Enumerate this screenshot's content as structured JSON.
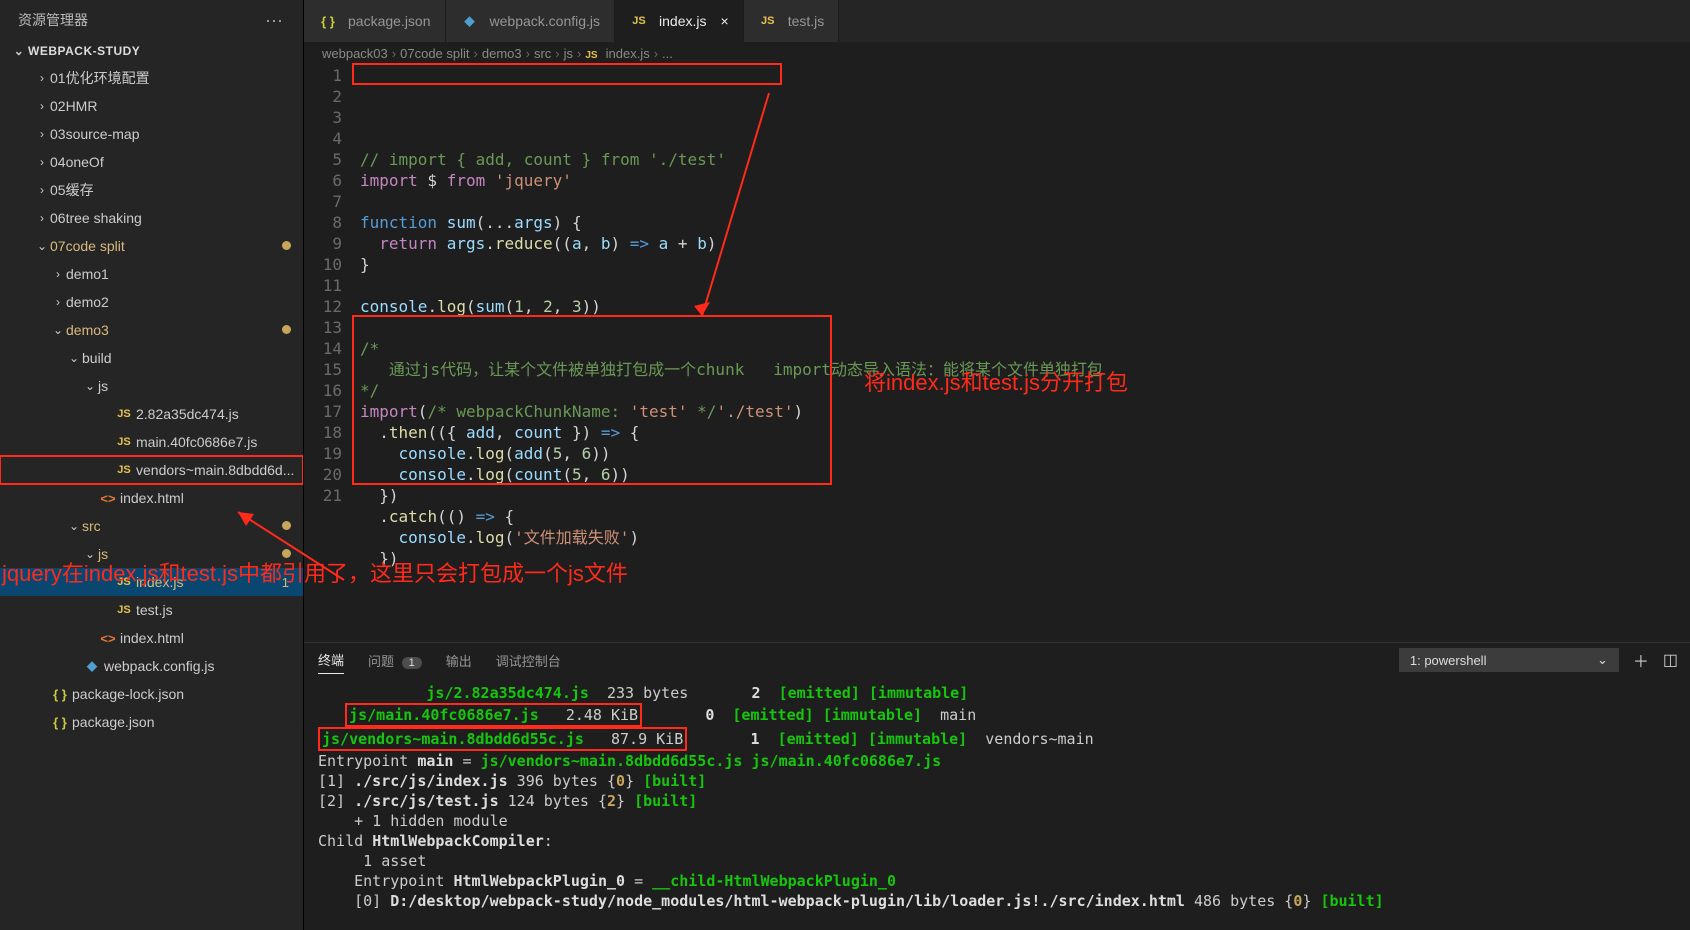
{
  "sidebar": {
    "title": "资源管理器",
    "project": "WEBPACK-STUDY",
    "items": [
      {
        "name": "01优化环境配置",
        "kind": "folder",
        "depth": 1,
        "open": false
      },
      {
        "name": "02HMR",
        "kind": "folder",
        "depth": 1,
        "open": false
      },
      {
        "name": "03source-map",
        "kind": "folder",
        "depth": 1,
        "open": false
      },
      {
        "name": "04oneOf",
        "kind": "folder",
        "depth": 1,
        "open": false
      },
      {
        "name": "05缓存",
        "kind": "folder",
        "depth": 1,
        "open": false
      },
      {
        "name": "06tree shaking",
        "kind": "folder",
        "depth": 1,
        "open": false
      },
      {
        "name": "07code split",
        "kind": "folder",
        "depth": 1,
        "open": true,
        "mod": true,
        "yellow": true
      },
      {
        "name": "demo1",
        "kind": "folder",
        "depth": 2,
        "open": false
      },
      {
        "name": "demo2",
        "kind": "folder",
        "depth": 2,
        "open": false
      },
      {
        "name": "demo3",
        "kind": "folder",
        "depth": 2,
        "open": true,
        "mod": true,
        "yellow": true
      },
      {
        "name": "build",
        "kind": "folder",
        "depth": 3,
        "open": true
      },
      {
        "name": "js",
        "kind": "folder",
        "depth": 4,
        "open": true
      },
      {
        "name": "2.82a35dc474.js",
        "kind": "js",
        "depth": 5
      },
      {
        "name": "main.40fc0686e7.js",
        "kind": "js",
        "depth": 5
      },
      {
        "name": "vendors~main.8dbdd6d...",
        "kind": "js",
        "depth": 5,
        "boxed": true
      },
      {
        "name": "index.html",
        "kind": "html",
        "depth": 4
      },
      {
        "name": "src",
        "kind": "folder",
        "depth": 3,
        "open": true,
        "hidden_label": true,
        "mod": true,
        "yellow": true
      },
      {
        "name": "js",
        "kind": "folder",
        "depth": 4,
        "open": true,
        "mod": true,
        "yellow": true
      },
      {
        "name": "index.js",
        "kind": "js",
        "depth": 5,
        "active": true,
        "yellow": true,
        "modnum": "1"
      },
      {
        "name": "test.js",
        "kind": "js",
        "depth": 5
      },
      {
        "name": "index.html",
        "kind": "html",
        "depth": 4
      },
      {
        "name": "webpack.config.js",
        "kind": "wp",
        "depth": 3
      },
      {
        "name": "package-lock.json",
        "kind": "json",
        "depth": 1
      },
      {
        "name": "package.json",
        "kind": "json",
        "depth": 1
      }
    ]
  },
  "tabs": [
    {
      "icon": "json",
      "label": "package.json"
    },
    {
      "icon": "wp",
      "label": "webpack.config.js"
    },
    {
      "icon": "js",
      "label": "index.js",
      "active": true,
      "close": true
    },
    {
      "icon": "js",
      "label": "test.js"
    }
  ],
  "breadcrumb": [
    "webpack03",
    "07code split",
    "demo3",
    "src",
    "js",
    "index.js",
    "..."
  ],
  "breadcrumb_icon_at": 5,
  "code_lines": [
    "// import { add, count } from './test'",
    "import $ from 'jquery'",
    "",
    "function sum(...args) {",
    "  return args.reduce((a, b) => a + b)",
    "}",
    "",
    "console.log(sum(1, 2, 3))",
    "",
    "/*",
    "   通过js代码，让某个文件被单独打包成一个chunk   import动态导入语法：能将某个文件单独打包",
    "*/",
    "import(/* webpackChunkName: 'test' */'./test')",
    "  .then(({ add, count }) => {",
    "    console.log(add(5, 6))",
    "    console.log(count(5, 6))",
    "  })",
    "  .catch(() => {",
    "    console.log('文件加载失败')",
    "  })",
    ""
  ],
  "annotations": {
    "right_text": "将index.js和test.js分开打包",
    "overlay_text": "jquery在index.js和test.js中都引用了，这里只会打包成一个js文件"
  },
  "panel": {
    "tabs": {
      "terminal": "终端",
      "problems": "问题",
      "problems_count": "1",
      "output": "输出",
      "debug": "调试控制台"
    },
    "shell": "1: powershell"
  },
  "terminal_lines": [
    {
      "segments": [
        {
          "t": "            ",
          "c": ""
        },
        {
          "t": "js/2.82a35dc474.js",
          "c": "g"
        },
        {
          "t": "  233 bytes       ",
          "c": ""
        },
        {
          "t": "2",
          "c": "w"
        },
        {
          "t": "  ",
          "c": ""
        },
        {
          "t": "[emitted] [immutable]",
          "c": "g"
        }
      ]
    },
    {
      "segments": [
        {
          "t": "   ",
          "c": ""
        },
        {
          "t": "js/main.40fc0686e7.js",
          "c": "g",
          "box": true
        },
        {
          "t": "   2.48 KiB",
          "c": "",
          "box": true
        },
        {
          "t": "       ",
          "c": ""
        },
        {
          "t": "0",
          "c": "w"
        },
        {
          "t": "  ",
          "c": ""
        },
        {
          "t": "[emitted] [immutable]",
          "c": "g"
        },
        {
          "t": "  main",
          "c": ""
        }
      ]
    },
    {
      "segments": [
        {
          "t": "",
          "c": ""
        },
        {
          "t": "js/vendors~main.8dbdd6d55c.js",
          "c": "g",
          "box": true
        },
        {
          "t": "   87.9 KiB",
          "c": "",
          "box": true
        },
        {
          "t": "       ",
          "c": ""
        },
        {
          "t": "1",
          "c": "w"
        },
        {
          "t": "  ",
          "c": ""
        },
        {
          "t": "[emitted] [immutable]",
          "c": "g"
        },
        {
          "t": "  vendors~main",
          "c": ""
        }
      ]
    },
    {
      "segments": [
        {
          "t": "Entrypoint ",
          "c": ""
        },
        {
          "t": "main",
          "c": "w"
        },
        {
          "t": " = ",
          "c": ""
        },
        {
          "t": "js/vendors~main.8dbdd6d55c.js js/main.40fc0686e7.js",
          "c": "g"
        }
      ]
    },
    {
      "segments": [
        {
          "t": "[1] ",
          "c": ""
        },
        {
          "t": "./src/js/index.js",
          "c": "w"
        },
        {
          "t": " 396 bytes {",
          "c": ""
        },
        {
          "t": "0",
          "c": "y"
        },
        {
          "t": "} ",
          "c": ""
        },
        {
          "t": "[built]",
          "c": "g"
        }
      ]
    },
    {
      "segments": [
        {
          "t": "[2] ",
          "c": ""
        },
        {
          "t": "./src/js/test.js",
          "c": "w"
        },
        {
          "t": " 124 bytes {",
          "c": ""
        },
        {
          "t": "2",
          "c": "y"
        },
        {
          "t": "} ",
          "c": ""
        },
        {
          "t": "[built]",
          "c": "g"
        }
      ]
    },
    {
      "segments": [
        {
          "t": "    + 1 hidden module",
          "c": ""
        }
      ]
    },
    {
      "segments": [
        {
          "t": "Child ",
          "c": ""
        },
        {
          "t": "HtmlWebpackCompiler",
          "c": "w"
        },
        {
          "t": ":",
          "c": ""
        }
      ]
    },
    {
      "segments": [
        {
          "t": "     1 asset",
          "c": ""
        }
      ]
    },
    {
      "segments": [
        {
          "t": "    Entrypoint ",
          "c": ""
        },
        {
          "t": "HtmlWebpackPlugin_0",
          "c": "w"
        },
        {
          "t": " = ",
          "c": ""
        },
        {
          "t": "__child-HtmlWebpackPlugin_0",
          "c": "g"
        }
      ]
    },
    {
      "segments": [
        {
          "t": "    [0] ",
          "c": ""
        },
        {
          "t": "D:/desktop/webpack-study/node_modules/html-webpack-plugin/lib/loader.js!./src/index.html",
          "c": "w"
        },
        {
          "t": " 486 bytes {",
          "c": ""
        },
        {
          "t": "0",
          "c": "y"
        },
        {
          "t": "} ",
          "c": ""
        },
        {
          "t": "[built]",
          "c": "g"
        }
      ]
    }
  ]
}
